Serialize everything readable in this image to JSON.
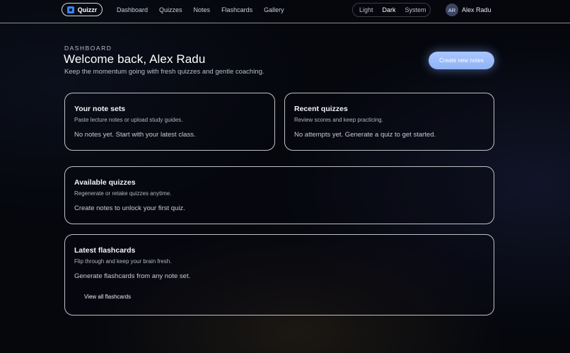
{
  "nav": {
    "brand": "Quizzr",
    "links": [
      "Dashboard",
      "Quizzes",
      "Notes",
      "Flashcards",
      "Gallery"
    ],
    "theme_options": [
      "Light",
      "Dark",
      "System"
    ],
    "theme_selected": "Dark",
    "user_initials": "AR",
    "user_name": "Alex Radu"
  },
  "header": {
    "eyebrow": "DASHBOARD",
    "title": "Welcome back, Alex Radu",
    "subtitle": "Keep the momentum going with fresh quizzes and gentle coaching.",
    "create_button": "Create new notes"
  },
  "cards": {
    "notes": {
      "title": "Your note sets",
      "description": "Paste lecture notes or upload study guides.",
      "empty": "No notes yet. Start with your latest class."
    },
    "recent": {
      "title": "Recent quizzes",
      "description": "Review scores and keep practicing.",
      "empty": "No attempts yet. Generate a quiz to get started."
    },
    "available": {
      "title": "Available quizzes",
      "description": "Regenerate or retake quizzes anytime.",
      "empty": "Create notes to unlock your first quiz."
    },
    "flashcards": {
      "title": "Latest flashcards",
      "description": "Flip through and keep your brain fresh.",
      "empty": "Generate flashcards from any note set.",
      "link": "View all flashcards"
    }
  },
  "colors": {
    "background": "#05070d",
    "accent": "#8fb3f5",
    "brand_icon": "#3b82f6"
  }
}
